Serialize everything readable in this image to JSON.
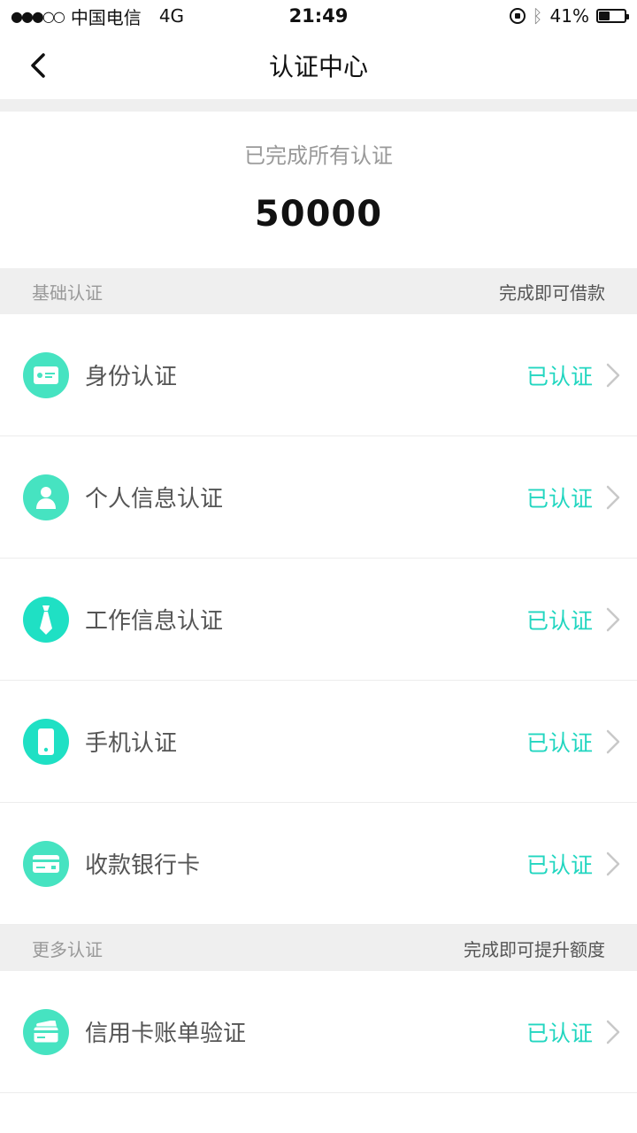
{
  "status_bar": {
    "signal": "●●●○○",
    "carrier": "中国电信",
    "network": "4G",
    "time": "21:49",
    "battery_text": "41%",
    "battery_level": 0.41
  },
  "nav": {
    "title": "认证中心"
  },
  "summary": {
    "text": "已完成所有认证",
    "amount": "50000"
  },
  "sections": [
    {
      "left": "基础认证",
      "right": "完成即可借款",
      "items": [
        {
          "label": "身份认证",
          "status": "已认证",
          "icon": "id-card-icon"
        },
        {
          "label": "个人信息认证",
          "status": "已认证",
          "icon": "person-icon"
        },
        {
          "label": "工作信息认证",
          "status": "已认证",
          "icon": "tie-icon"
        },
        {
          "label": "手机认证",
          "status": "已认证",
          "icon": "phone-icon"
        },
        {
          "label": "收款银行卡",
          "status": "已认证",
          "icon": "bank-card-icon"
        }
      ]
    },
    {
      "left": "更多认证",
      "right": "完成即可提升额度",
      "items": [
        {
          "label": "信用卡账单验证",
          "status": "已认证",
          "icon": "credit-card-icon"
        }
      ]
    }
  ],
  "colors": {
    "accent": "#22d6c0",
    "icon_bg": "#46e3c1",
    "section_bg": "#efefef"
  }
}
